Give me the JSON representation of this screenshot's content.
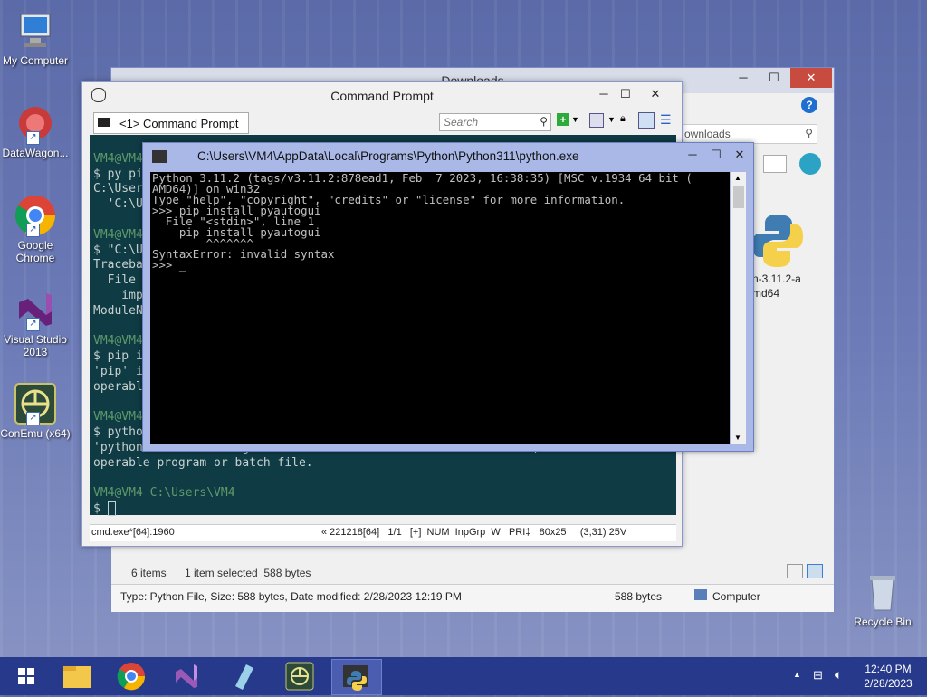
{
  "desktop": {
    "icons": [
      {
        "label": "My Computer",
        "icon": "my-computer-icon"
      },
      {
        "label": "DataWagon...",
        "icon": "datawagon-icon"
      },
      {
        "label": "Google Chrome",
        "icon": "chrome-icon"
      },
      {
        "label": "Visual Studio 2013",
        "icon": "visual-studio-icon"
      },
      {
        "label": "ConEmu (x64)",
        "icon": "conemu-icon"
      },
      {
        "label": "Recycle Bin",
        "icon": "recycle-bin-icon"
      }
    ]
  },
  "explorer": {
    "title": "Downloads",
    "search_placeholder": "ownloads",
    "file_label_line1": "n-3.11.2-a",
    "file_label_line2": "md64",
    "status_items": "6 items",
    "status_selected": "1 item selected  588 bytes",
    "details_text": "Type: Python File, Size: 588 bytes, Date modified: 2/28/2023 12:19 PM",
    "details_size": "588 bytes",
    "details_location": "Computer"
  },
  "conemu": {
    "title": "Command Prompt",
    "tab_label": "<1> Command Prompt",
    "search_placeholder": "Search",
    "console_lines": [
      "",
      "VM4@VM4",
      "$ py pi",
      "C:\\User",
      "  'C:\\U",
      "",
      "VM4@VM4",
      "$ \"C:\\U",
      "Traceba",
      "  File",
      "    imp",
      "ModuleN",
      "",
      "VM4@VM4",
      "$ pip i",
      "'pip' i",
      "operabl",
      "",
      "VM4@VM4",
      "$ pytho",
      "'pythons' is not recognized as an internal or external command,",
      "operable program or batch file.",
      "",
      "VM4@VM4 C:\\Users\\VM4",
      "$ "
    ],
    "status_left": "cmd.exe*[64]:1960",
    "status_right": "« 221218[64]   1/1   [+]  NUM  InpGrp  W   PRI‡   80x25     (3,31) 25V"
  },
  "python_window": {
    "title": "C:\\Users\\VM4\\AppData\\Local\\Programs\\Python\\Python311\\python.exe",
    "console_lines": [
      "Python 3.11.2 (tags/v3.11.2:878ead1, Feb  7 2023, 16:38:35) [MSC v.1934 64 bit (",
      "AMD64)] on win32",
      "Type \"help\", \"copyright\", \"credits\" or \"license\" for more information.",
      ">>> pip install pyautogui",
      "  File \"<stdin>\", line 1",
      "    pip install pyautogui",
      "        ^^^^^^^",
      "SyntaxError: invalid syntax",
      ">>> _"
    ]
  },
  "taskbar": {
    "items": [
      "start-icon",
      "file-explorer-icon",
      "chrome-icon",
      "visual-studio-icon",
      "notepad-icon",
      "conemu-icon",
      "python-icon"
    ],
    "time": "12:40 PM",
    "date": "2/28/2023"
  },
  "colors": {
    "console_bg": "#0f3b45",
    "python_console_bg": "#000000",
    "taskbar": "#27398a",
    "close_button": "#c74b3e"
  }
}
